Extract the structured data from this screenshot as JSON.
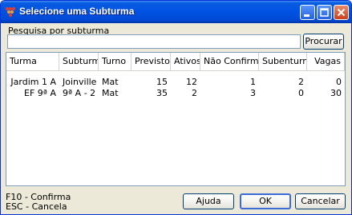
{
  "window": {
    "title": "Selecione uma Subturma"
  },
  "search": {
    "label": "Pesquisa por subturma",
    "value": "",
    "placeholder": "",
    "button": "Procurar"
  },
  "table": {
    "columns": [
      "Turma",
      "Subturma",
      "Turno",
      "Previstos",
      "Ativos",
      "Não Confirmado",
      "Subenturm...",
      "Vagas"
    ],
    "rows": [
      [
        "Jardim 1 A",
        "Joinville",
        "Mat",
        "15",
        "12",
        "1",
        "2",
        "0"
      ],
      [
        "EF 9ª A",
        "9ª A - 2",
        "Mat",
        "35",
        "2",
        "3",
        "0",
        "30"
      ]
    ]
  },
  "footer": {
    "hint_confirm": "F10 - Confirma",
    "hint_cancel": "ESC - Cancela",
    "help_button": "Ajuda",
    "ok_button": "OK",
    "cancel_button": "Cancelar"
  },
  "colors": {
    "titlebar": "#0053e3",
    "window_bg": "#ece9d8",
    "border": "#7f9db9"
  },
  "icons": {
    "app": "app-dots-icon",
    "minimize": "minimize-icon",
    "maximize": "maximize-icon",
    "close": "close-icon"
  }
}
